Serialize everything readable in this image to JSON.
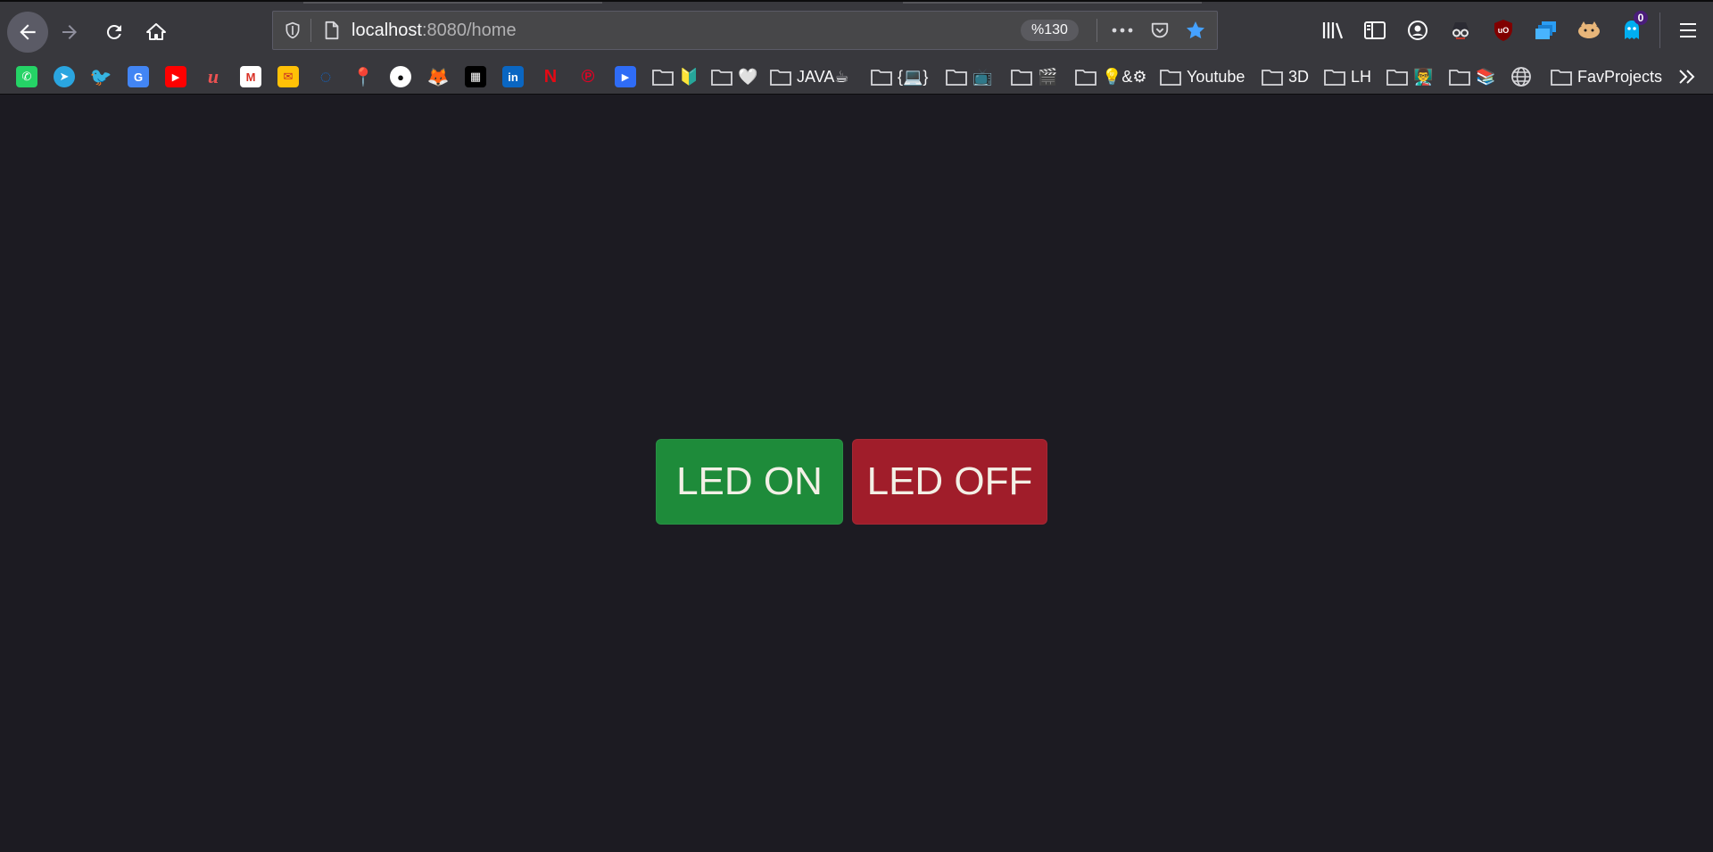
{
  "browser": {
    "url_host": "localhost",
    "url_rest": ":8080/home",
    "zoom": "%130",
    "notification_count": "0"
  },
  "bookmarks": {
    "folders": [
      {
        "label": "🔰"
      },
      {
        "label": "🤍"
      },
      {
        "label": "JAVA☕"
      },
      {
        "label": "{💻}"
      },
      {
        "label": "📺"
      },
      {
        "label": "🎬"
      },
      {
        "label": "💡&⚙"
      },
      {
        "label": "Youtube"
      },
      {
        "label": "3D"
      },
      {
        "label": "LH"
      },
      {
        "label": "👨‍🏫"
      },
      {
        "label": "📚"
      },
      {
        "label": "FavProjects"
      }
    ]
  },
  "page": {
    "led_on_label": "LED ON",
    "led_off_label": "LED OFF"
  },
  "colors": {
    "led_on": "#1e8b3a",
    "led_off": "#a01d2a",
    "background": "#1c1b22",
    "toolbar": "#38383d"
  }
}
